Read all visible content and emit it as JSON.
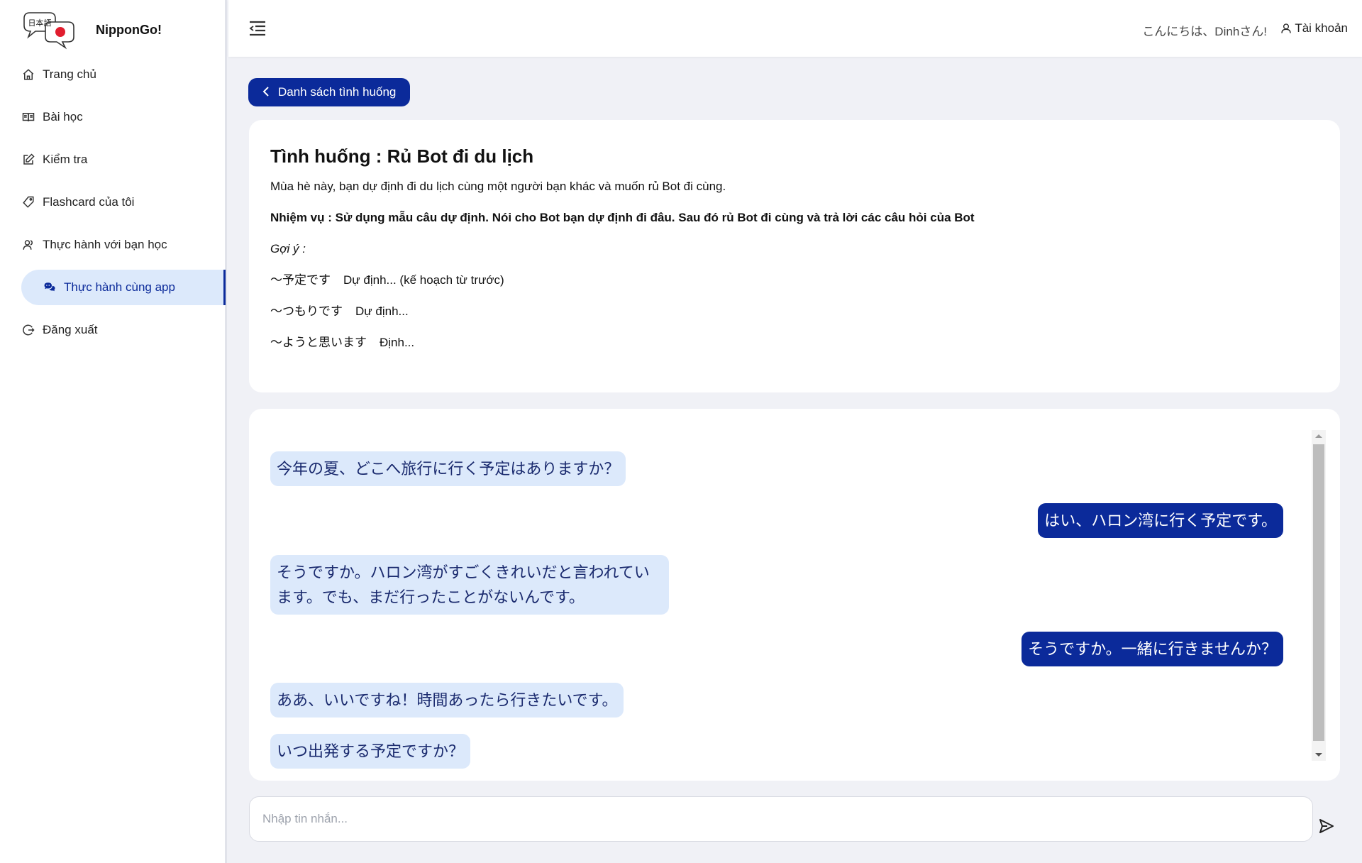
{
  "brand": {
    "name": "NipponGo!",
    "logo_text": "日本語"
  },
  "sidebar": {
    "items": [
      {
        "label": "Trang chủ",
        "icon": "home-icon"
      },
      {
        "label": "Bài học",
        "icon": "book-icon"
      },
      {
        "label": "Kiểm tra",
        "icon": "edit-icon"
      },
      {
        "label": "Flashcard của tôi",
        "icon": "tag-icon"
      },
      {
        "label": "Thực hành với bạn học",
        "icon": "users-icon"
      },
      {
        "label": "Thực hành cùng app",
        "icon": "chat-icon",
        "active": true
      },
      {
        "label": "Đăng xuất",
        "icon": "logout-icon"
      }
    ]
  },
  "header": {
    "greeting": "こんにちは、Dinhさん!",
    "account_label": "Tài khoản"
  },
  "back_button": {
    "label": "Danh sách tình huống"
  },
  "scenario": {
    "title": "Tình huống : Rủ Bot đi du lịch",
    "description": "Mùa hè này, bạn dự định đi du lịch cùng một người bạn khác và muốn rủ Bot đi cùng.",
    "task": "Nhiệm vụ : Sử dụng mẫu câu dự định. Nói cho Bot bạn dự định đi đâu. Sau đó rủ Bot đi cùng và trả lời các câu hỏi của Bot",
    "hint_label": "Gợi ý :",
    "hints": [
      {
        "pattern": "～予定です",
        "meaning": "Dự định... (kế hoạch từ trước)"
      },
      {
        "pattern": "～つもりです",
        "meaning": "Dự định..."
      },
      {
        "pattern": "～ようと思います",
        "meaning": "Định..."
      }
    ]
  },
  "chat": {
    "messages": [
      {
        "role": "bot",
        "text": "今年の夏、どこへ旅行に行く予定はありますか？"
      },
      {
        "role": "user",
        "text": "はい、ハロン湾に行く予定です。"
      },
      {
        "role": "bot",
        "text": "そうですか。ハロン湾がすごくきれいだと言われています。でも、まだ行ったことがないんです。"
      },
      {
        "role": "user",
        "text": "そうですか。一緒に行きませんか？"
      },
      {
        "role": "bot",
        "text": "ああ、いいですね！時間あったら行きたいです。"
      },
      {
        "role": "bot",
        "text": "いつ出発する予定ですか？"
      }
    ]
  },
  "input": {
    "placeholder": "Nhập tin nhắn...",
    "value": ""
  },
  "colors": {
    "primary": "#0b2a9a",
    "bot_bubble": "#dce9fb",
    "background": "#f0f1f6"
  }
}
